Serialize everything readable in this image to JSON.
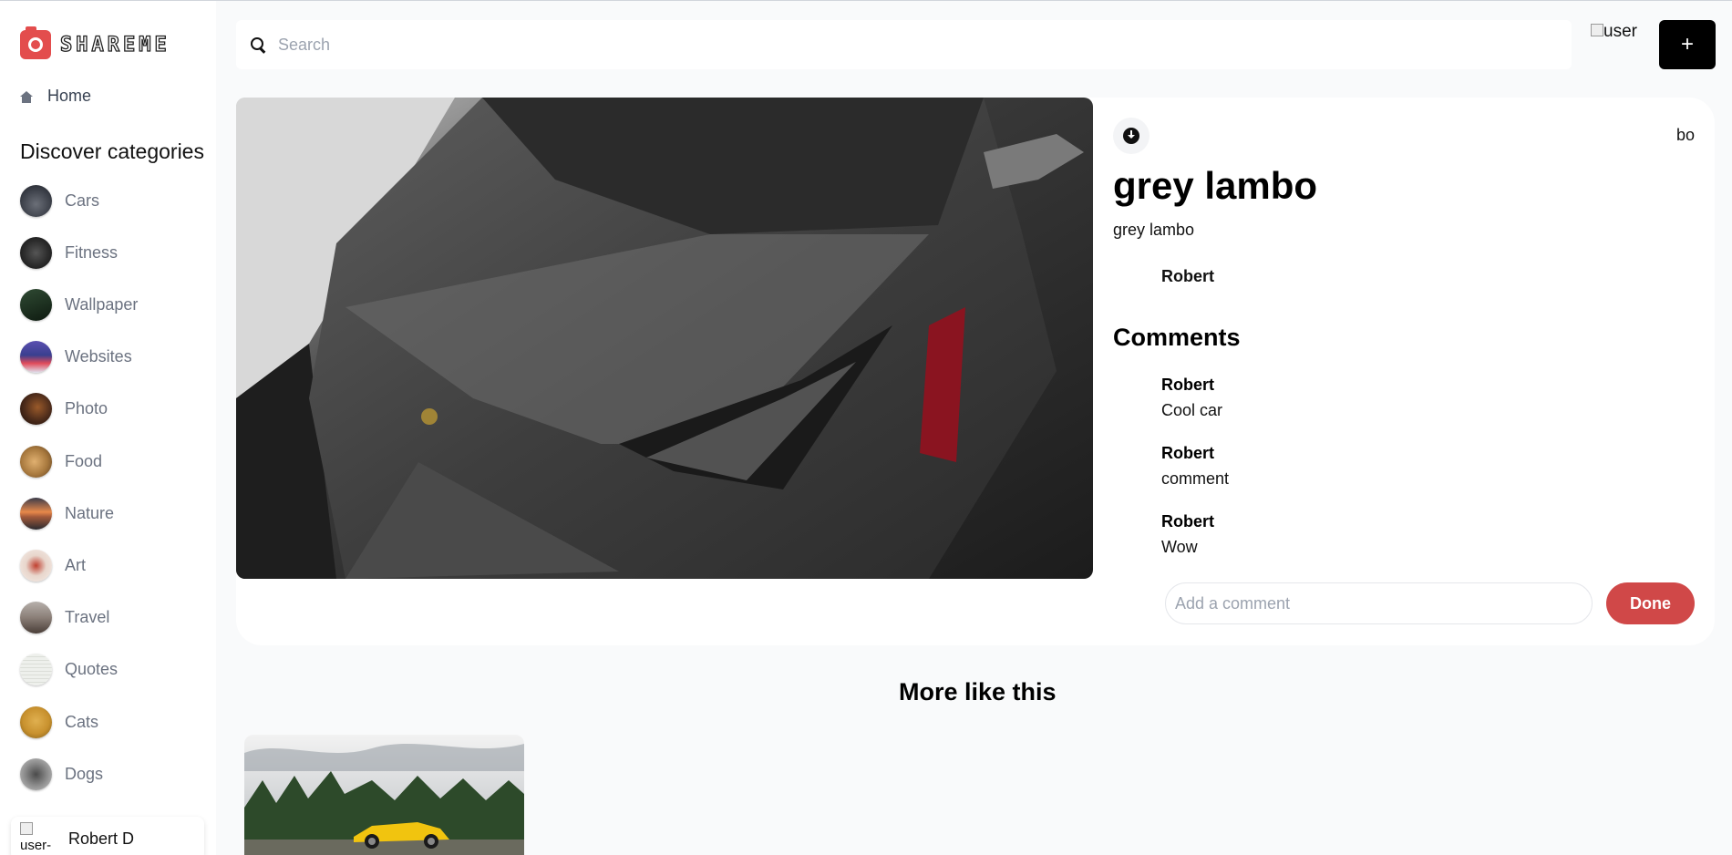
{
  "app": {
    "logo_text": "SHAREME"
  },
  "sidebar": {
    "home_label": "Home",
    "discover_heading": "Discover categories",
    "categories": [
      {
        "label": "Cars",
        "color": "#3b3f48"
      },
      {
        "label": "Fitness",
        "color": "#2b2b2b"
      },
      {
        "label": "Wallpaper",
        "color": "#1f3322"
      },
      {
        "label": "Websites",
        "color": "#3a3f8f"
      },
      {
        "label": "Photo",
        "color": "#4a2a1a"
      },
      {
        "label": "Food",
        "color": "#a8793e"
      },
      {
        "label": "Nature",
        "color": "#a35a3a"
      },
      {
        "label": "Art",
        "color": "#e8d6cc"
      },
      {
        "label": "Travel",
        "color": "#8b7f78"
      },
      {
        "label": "Quotes",
        "color": "#eef0ec"
      },
      {
        "label": "Cats",
        "color": "#c8912e"
      },
      {
        "label": "Dogs",
        "color": "#8c8c8c"
      }
    ],
    "user": {
      "img_alt": "user-",
      "name": "Robert D"
    }
  },
  "topbar": {
    "search_placeholder": "Search",
    "user_img_alt": "user",
    "add_label": "+"
  },
  "pin": {
    "destination": "bo",
    "title": "grey lambo",
    "about": "grey lambo",
    "posted_by": "Robert",
    "comments_heading": "Comments",
    "comments": [
      {
        "name": "Robert",
        "text": "Cool car"
      },
      {
        "name": "Robert",
        "text": "comment"
      },
      {
        "name": "Robert",
        "text": "Wow"
      }
    ],
    "comment_placeholder": "Add a comment",
    "done_label": "Done"
  },
  "more": {
    "heading": "More like this"
  },
  "colors": {
    "accent": "#d04848",
    "logo": "#e34d4d",
    "sidebar_bg": "#ffffff",
    "page_bg": "#f9fafb"
  }
}
